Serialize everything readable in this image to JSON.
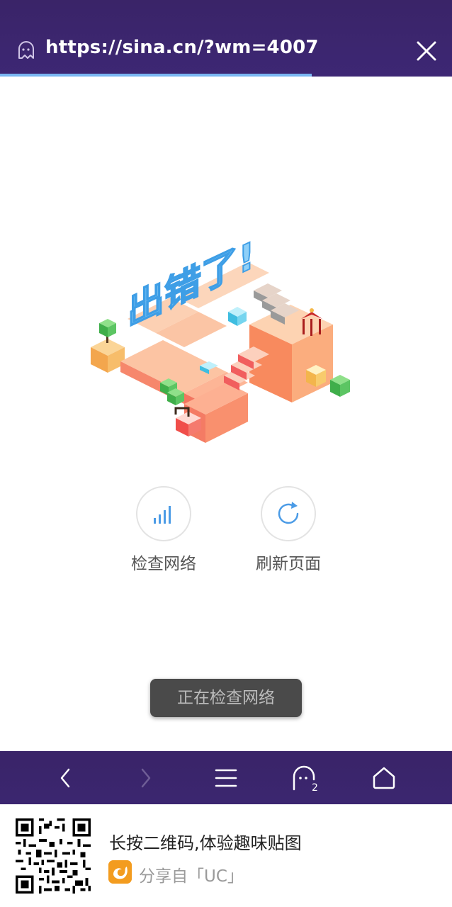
{
  "browser": {
    "url": "https://sina.cn/?wm=4007",
    "load_progress_percent": 69
  },
  "error_illustration": {
    "text": "出错了!"
  },
  "actions": {
    "check_network": "检查网络",
    "refresh_page": "刷新页面"
  },
  "toast": "正在检查网络",
  "bottom_nav": {
    "tab_count": "2",
    "icons": [
      "back-icon",
      "forward-icon",
      "menu-icon",
      "tabs-icon",
      "home-icon"
    ]
  },
  "share": {
    "headline": "长按二维码,体验趣味贴图",
    "source": "分享自「UC」"
  },
  "colors": {
    "bar_background": "#3c2670",
    "progress": "#79b6f2",
    "toast_background": "#4a4a4a",
    "icon_blue": "#4b9be6",
    "uc_orange": "#f39c1f"
  }
}
